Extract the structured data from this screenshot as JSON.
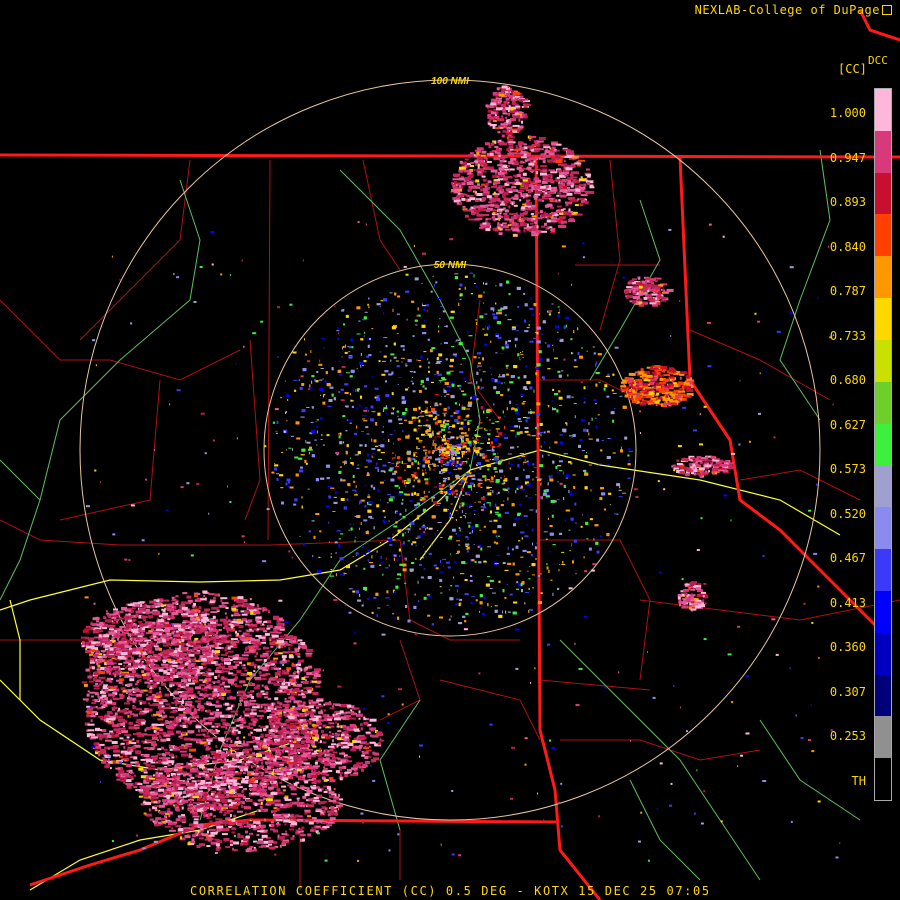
{
  "header": {
    "credit": "NEXLAB-College of DuPage",
    "corner_code": "DCC"
  },
  "legend": {
    "unit": "[CC]",
    "labels": [
      "1.000",
      "0.947",
      "0.893",
      "0.840",
      "0.787",
      "0.733",
      "0.680",
      "0.627",
      "0.573",
      "0.520",
      "0.467",
      "0.413",
      "0.360",
      "0.307",
      "0.253",
      "TH"
    ],
    "colors": [
      "#ffb6d9",
      "#d8397a",
      "#c8102e",
      "#ff4000",
      "#ff9800",
      "#ffd800",
      "#c9e000",
      "#6fcf2a",
      "#3ef03e",
      "#a0a0d0",
      "#8a8af0",
      "#3a3af8",
      "#0000ff",
      "#0000c0",
      "#00007a",
      "#909090",
      "#000000"
    ]
  },
  "range_rings": [
    {
      "label": "100 NMI"
    },
    {
      "label": "50 NMI"
    }
  ],
  "footer": {
    "product_line": "CORRELATION COEFFICIENT (CC) 0.5 DEG - KOTX 15 DEC 25 07:05"
  },
  "colors": {
    "state_border": "#ff1a1a",
    "county_line": "#cc1111",
    "highway": "#ffff33",
    "river": "#66cc66",
    "range_ring": "#e8c4a0",
    "text": "#ffd700"
  }
}
